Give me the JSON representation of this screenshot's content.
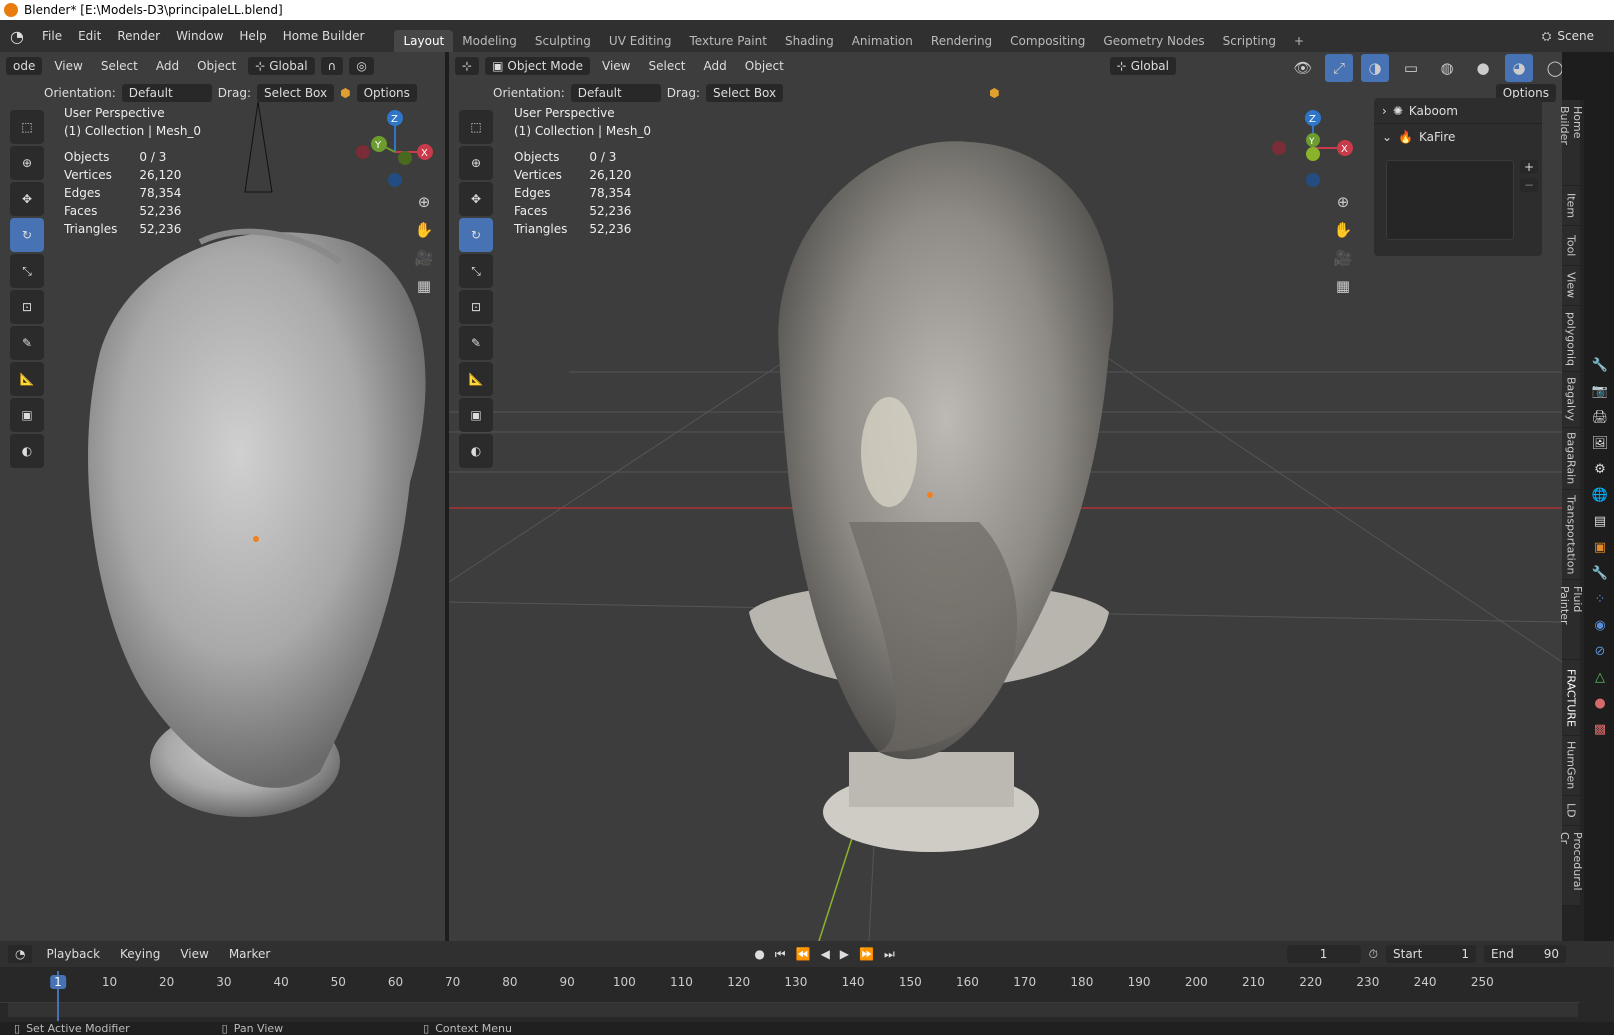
{
  "title": "Blender* [E:\\Models-D3\\principaleLL.blend]",
  "menu": [
    "File",
    "Edit",
    "Render",
    "Window",
    "Help",
    "Home Builder"
  ],
  "workspaces": [
    "Layout",
    "Modeling",
    "Sculpting",
    "UV Editing",
    "Texture Paint",
    "Shading",
    "Animation",
    "Rendering",
    "Compositing",
    "Geometry Nodes",
    "Scripting"
  ],
  "active_workspace": "Layout",
  "scene_label": "Scene",
  "left_vp": {
    "mode": "ode",
    "menus": [
      "View",
      "Select",
      "Add",
      "Object"
    ],
    "transform": "Global",
    "orientation_label": "Orientation:",
    "orientation": "Default",
    "drag_label": "Drag:",
    "drag": "Select Box",
    "options": "Options",
    "persp": "User Perspective",
    "collection": "(1) Collection | Mesh_0",
    "stats": [
      [
        "Objects",
        "0 / 3"
      ],
      [
        "Vertices",
        "26,120"
      ],
      [
        "Edges",
        "78,354"
      ],
      [
        "Faces",
        "52,236"
      ],
      [
        "Triangles",
        "52,236"
      ]
    ]
  },
  "right_vp": {
    "mode": "Object Mode",
    "menus": [
      "View",
      "Select",
      "Add",
      "Object"
    ],
    "transform": "Global",
    "orientation_label": "Orientation:",
    "orientation": "Default",
    "drag_label": "Drag:",
    "drag": "Select Box",
    "options": "Options",
    "persp": "User Perspective",
    "collection": "(1) Collection | Mesh_0",
    "stats": [
      [
        "Objects",
        "0 / 3"
      ],
      [
        "Vertices",
        "26,120"
      ],
      [
        "Edges",
        "78,354"
      ],
      [
        "Faces",
        "52,236"
      ],
      [
        "Triangles",
        "52,236"
      ]
    ]
  },
  "npanel": {
    "panels": [
      "Kaboom",
      "KaFire"
    ]
  },
  "side_tabs": [
    "Home Builder",
    "Item",
    "Tool",
    "View",
    "polygoniq",
    "Bagalvy",
    "BagaRain",
    "Transportation",
    "Fluid Painter",
    "FRACTURE",
    "HumGen",
    "LD",
    "Procedural Cr"
  ],
  "gizmo": {
    "x": "X",
    "y": "Y",
    "z": "Z"
  },
  "timeline": {
    "menus": [
      "Playback",
      "Keying",
      "View",
      "Marker"
    ],
    "current_frame": "1",
    "start_label": "Start",
    "start": "1",
    "end_label": "End",
    "end": "90",
    "ticks": [
      "1",
      "10",
      "20",
      "30",
      "40",
      "50",
      "60",
      "70",
      "80",
      "90",
      "100",
      "110",
      "120",
      "130",
      "140",
      "150",
      "160",
      "170",
      "180",
      "190",
      "200",
      "210",
      "220",
      "230",
      "240",
      "250"
    ]
  },
  "status": [
    "Set Active Modifier",
    "Pan View",
    "Context Menu"
  ],
  "colors": {
    "accent": "#4772b3",
    "x_axis": "#c93b4a",
    "y_axis": "#6c9b2f",
    "z_axis": "#2f76c9"
  }
}
